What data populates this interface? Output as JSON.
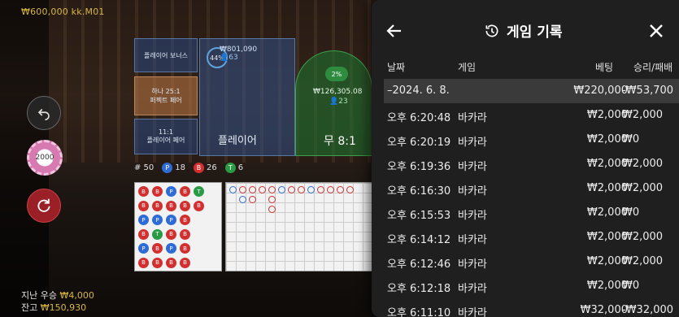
{
  "balance_top": "₩600,000 kk.M01",
  "bets": {
    "player_bonus": "플레이어 보너스",
    "perfect_pair_line1": "하나 25:1",
    "perfect_pair_line2": "퍼펙트 페어",
    "player_pair_line1": "11:1",
    "player_pair_line2": "플레이어 페어",
    "player_pct": "44%",
    "player_amount": "₩801,090",
    "player_count": "63",
    "player_label": "플레이어",
    "tie_pct": "2%",
    "tie_amount": "₩126,305.08",
    "tie_count": "23",
    "tie_label": "무 8:1"
  },
  "stats": {
    "total": "# 50",
    "p_letter": "P",
    "p_count": "18",
    "b_letter": "B",
    "b_count": "26",
    "t_letter": "T",
    "t_count": "6"
  },
  "bead_road": [
    [
      "B",
      "B",
      "P",
      "B",
      "T",
      ""
    ],
    [
      "B",
      "B",
      "B",
      "B",
      "B",
      ""
    ],
    [
      "P",
      "P",
      "P",
      "B",
      "",
      ""
    ],
    [
      "B",
      "T",
      "B",
      "B",
      "",
      ""
    ],
    [
      "P",
      "B",
      "P",
      "B",
      "",
      ""
    ],
    [
      "B",
      "B",
      "B",
      "B",
      "",
      ""
    ]
  ],
  "chip_value": "2000",
  "bottom": {
    "last_win_label": "지난 우승",
    "last_win_value": "₩4,000",
    "balance_label": "잔고",
    "balance_value": "₩150,930"
  },
  "panel": {
    "title": "게임 기록",
    "columns": {
      "date": "날짜",
      "game": "게임",
      "bet": "베팅",
      "winloss": "승리/패배"
    },
    "rows": [
      {
        "date": "–2024. 6. 8.",
        "game": "",
        "bet": "₩220,000",
        "winloss": "-₩53,700",
        "highlight": true
      },
      {
        "date": "오후 6:20:48",
        "game": "바카라",
        "bet": "₩2,000",
        "winloss": "₩2,000"
      },
      {
        "date": "오후 6:20:19",
        "game": "바카라",
        "bet": "₩2,000",
        "winloss": "₩0"
      },
      {
        "date": "오후 6:19:36",
        "game": "바카라",
        "bet": "₩2,000",
        "winloss": "₩2,000"
      },
      {
        "date": "오후 6:16:30",
        "game": "바카라",
        "bet": "₩2,000",
        "winloss": "₩2,000"
      },
      {
        "date": "오후 6:15:53",
        "game": "바카라",
        "bet": "₩2,000",
        "winloss": "₩0"
      },
      {
        "date": "오후 6:14:12",
        "game": "바카라",
        "bet": "₩2,000",
        "winloss": "₩2,000"
      },
      {
        "date": "오후 6:12:46",
        "game": "바카라",
        "bet": "₩2,000",
        "winloss": "₩2,000"
      },
      {
        "date": "오후 6:12:18",
        "game": "바카라",
        "bet": "₩2,000",
        "winloss": "₩0"
      },
      {
        "date": "오후 6:11:10",
        "game": "바카라",
        "bet": "₩32,000",
        "winloss": "-₩32,000"
      }
    ]
  }
}
